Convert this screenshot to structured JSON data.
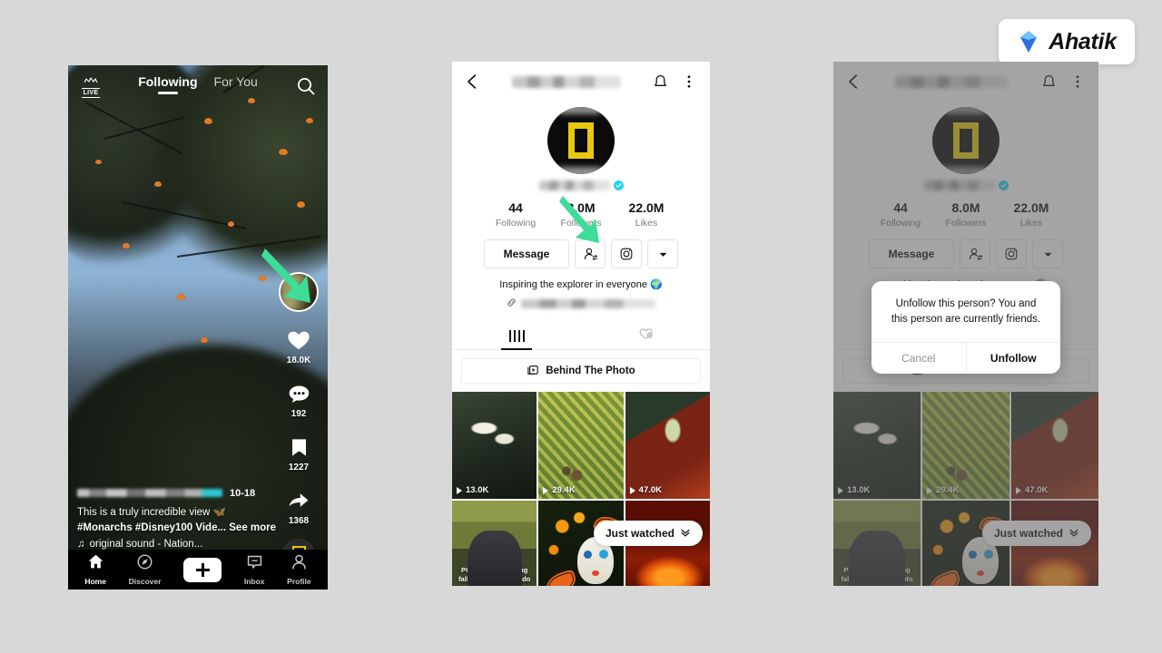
{
  "brand": {
    "name": "Ahatik",
    "logo_icon": "diamond-chevron-logo",
    "accent": "#3d8bfd"
  },
  "canvas": {
    "background": "#d8d8d8"
  },
  "annotations": {
    "color": "#3ddc97",
    "arrow1": {
      "icon": "arrow-pointer",
      "target": "feed-avatar"
    },
    "arrow2": {
      "icon": "arrow-pointer",
      "target": "follow-status-button"
    }
  },
  "phone1": {
    "name": "tiktok-feed-screen",
    "topbar": {
      "live_label": "LIVE",
      "live_icon": "live-icon",
      "tabs": [
        {
          "label": "Following",
          "active": true
        },
        {
          "label": "For You",
          "active": false
        }
      ],
      "search_icon": "search-icon"
    },
    "rail": {
      "avatar_icon": "creator-avatar",
      "items": [
        {
          "icon": "heart-icon",
          "count": "18.0K"
        },
        {
          "icon": "comment-icon",
          "count": "192"
        },
        {
          "icon": "bookmark-icon",
          "count": "1227"
        },
        {
          "icon": "share-icon",
          "count": "1368"
        }
      ],
      "disc_icon": "music-disc-icon"
    },
    "video": {
      "progress_time": "10-18",
      "caption_line1": "This is a truly incredible view 🦋",
      "caption_line2": "#Monarchs #Disney100  Vide...",
      "see_more": "See more",
      "sound_icon": "music-note-icon",
      "sound": "original sound - Nation..."
    },
    "nav": [
      {
        "icon": "home-icon",
        "label": "Home",
        "active": true
      },
      {
        "icon": "compass-icon",
        "label": "Discover",
        "active": false
      },
      {
        "icon": "plus-icon",
        "label": "",
        "active": false
      },
      {
        "icon": "inbox-icon",
        "label": "Inbox",
        "active": false
      },
      {
        "icon": "person-icon",
        "label": "Profile",
        "active": false
      }
    ]
  },
  "profile": {
    "name": "tiktok-profile-screen",
    "topbar": {
      "back_icon": "back-arrow-icon",
      "username": "",
      "bell_icon": "bell-icon",
      "more_icon": "three-dot-menu-icon"
    },
    "avatar_icon": "natgeo-avatar",
    "verified_icon": "verified-badge-icon",
    "stats": [
      {
        "value": "44",
        "label": "Following"
      },
      {
        "value": "8.0M",
        "label": "Followers"
      },
      {
        "value": "22.0M",
        "label": "Likes"
      }
    ],
    "actions": {
      "message_label": "Message",
      "follow_status_icon": "follow-status-icon",
      "instagram_icon": "instagram-icon",
      "dropdown_icon": "chevron-down-icon"
    },
    "bio": "Inspiring the explorer in everyone 🌍",
    "link_icon": "link-icon",
    "tabs": [
      {
        "icon": "grid-icon",
        "active": true
      },
      {
        "icon": "private-liked-icon",
        "active": false
      }
    ],
    "playlist": {
      "icon": "playlist-icon",
      "label": "Behind The Photo"
    },
    "grid": [
      {
        "thumb": "whales-aerial",
        "views": "13.0K",
        "caption": ""
      },
      {
        "thumb": "bear-in-wildflowers",
        "views": "29.4K",
        "caption": ""
      },
      {
        "thumb": "chrysalis-macro",
        "views": "47.0K",
        "caption": ""
      },
      {
        "thumb": "photographer-fall-colors",
        "views": "",
        "caption": "POV: Photographing\nfall colors in Colorado"
      },
      {
        "thumb": "marigolds-day-of-the-dead",
        "views": "",
        "caption": ""
      },
      {
        "thumb": "lava-flow",
        "views": "",
        "caption": ""
      }
    ],
    "pill": {
      "label": "Just watched",
      "icon": "double-chevron-down-icon"
    }
  },
  "dialog": {
    "name": "unfollow-confirm-dialog",
    "message": "Unfollow this person? You and this person are currently friends.",
    "cancel_label": "Cancel",
    "confirm_label": "Unfollow"
  }
}
